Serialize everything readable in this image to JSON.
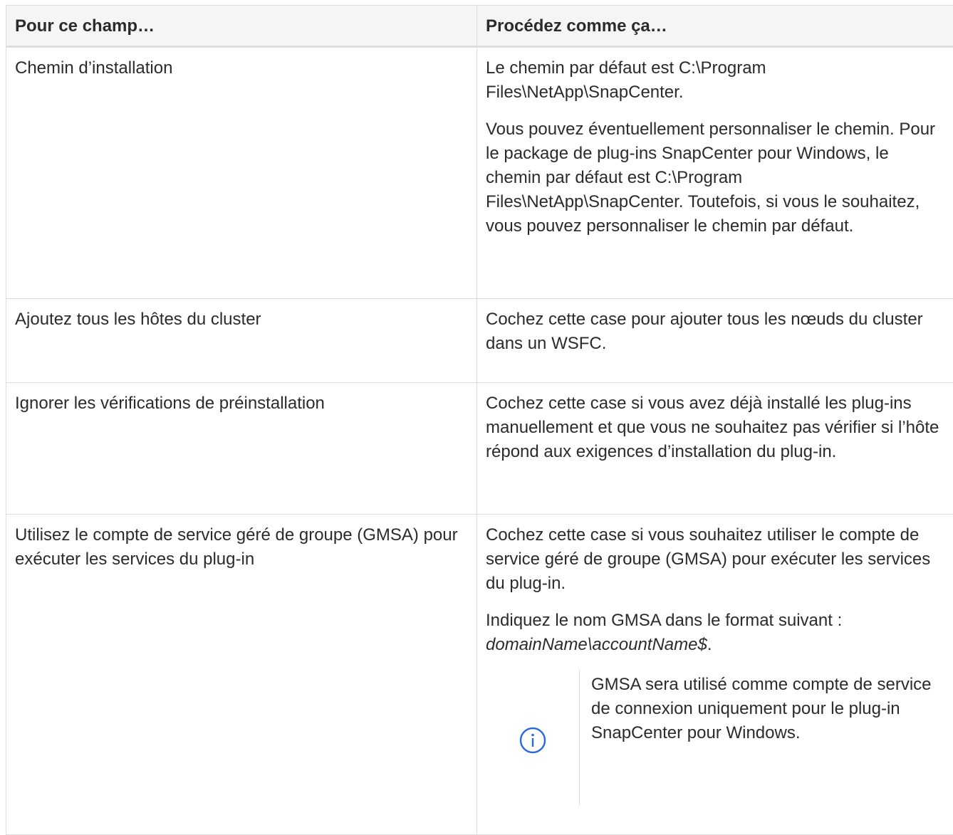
{
  "table": {
    "header": {
      "col1": "Pour ce champ…",
      "col2": "Procédez comme ça…"
    },
    "rows": [
      {
        "field": "Chemin d’installation",
        "action_p1": "Le chemin par défaut est C:\\Program Files\\NetApp\\SnapCenter.",
        "action_p2": "Vous pouvez éventuellement personnaliser le chemin. Pour le package de plug-ins SnapCenter pour Windows, le chemin par défaut est C:\\Program Files\\NetApp\\SnapCenter. Toutefois, si vous le souhaitez, vous pouvez personnaliser le chemin par défaut."
      },
      {
        "field": "Ajoutez tous les hôtes du cluster",
        "action_p1": "Cochez cette case pour ajouter tous les nœuds du cluster dans un WSFC."
      },
      {
        "field": "Ignorer les vérifications de préinstallation",
        "action_p1": "Cochez cette case si vous avez déjà installé les plug-ins manuellement et que vous ne souhaitez pas vérifier si l’hôte répond aux exigences d’installation du plug-in."
      },
      {
        "field": "Utilisez le compte de service géré de groupe (GMSA) pour exécuter les services du plug-in",
        "action_p1": "Cochez cette case si vous souhaitez utiliser le compte de service géré de groupe (GMSA) pour exécuter les services du plug-in.",
        "action_p2_prefix": "Indiquez le nom GMSA dans le format suivant :",
        "action_p2_code": "domainName\\accountName$",
        "action_p2_suffix": ".",
        "note": {
          "icon": "info-icon",
          "text": "GMSA sera utilisé comme compte de service de connexion uniquement pour le plug-in SnapCenter pour Windows."
        }
      }
    ]
  }
}
